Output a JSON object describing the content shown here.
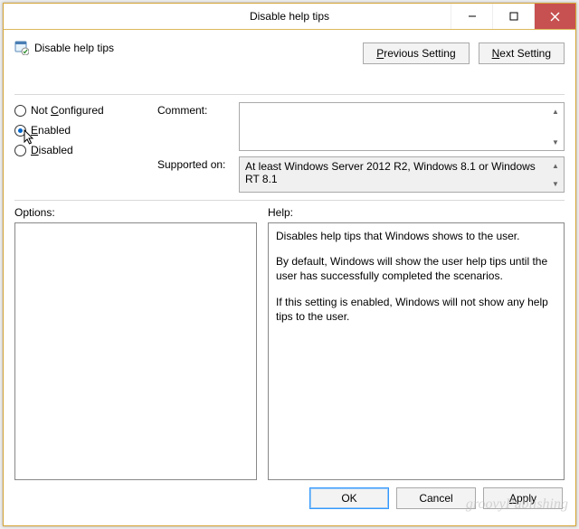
{
  "window": {
    "title": "Disable help tips"
  },
  "header": {
    "policy_name": "Disable help tips",
    "prev_button": "Previous Setting",
    "next_button": "Next Setting"
  },
  "state": {
    "not_configured": "Not Configured",
    "enabled": "Enabled",
    "disabled": "Disabled",
    "selected": "enabled"
  },
  "fields": {
    "comment_label": "Comment:",
    "comment_value": "",
    "supported_label": "Supported on:",
    "supported_value": "At least Windows Server 2012 R2, Windows 8.1 or Windows RT 8.1"
  },
  "panels": {
    "options_label": "Options:",
    "help_label": "Help:",
    "help_p1": "Disables help tips that Windows shows to the user.",
    "help_p2": "By default, Windows will show the user help tips until the user has successfully completed the scenarios.",
    "help_p3": "If this setting is enabled, Windows will not show any help tips to the user."
  },
  "buttons": {
    "ok": "OK",
    "cancel": "Cancel",
    "apply": "Apply"
  },
  "watermark": "groovyPublishing"
}
